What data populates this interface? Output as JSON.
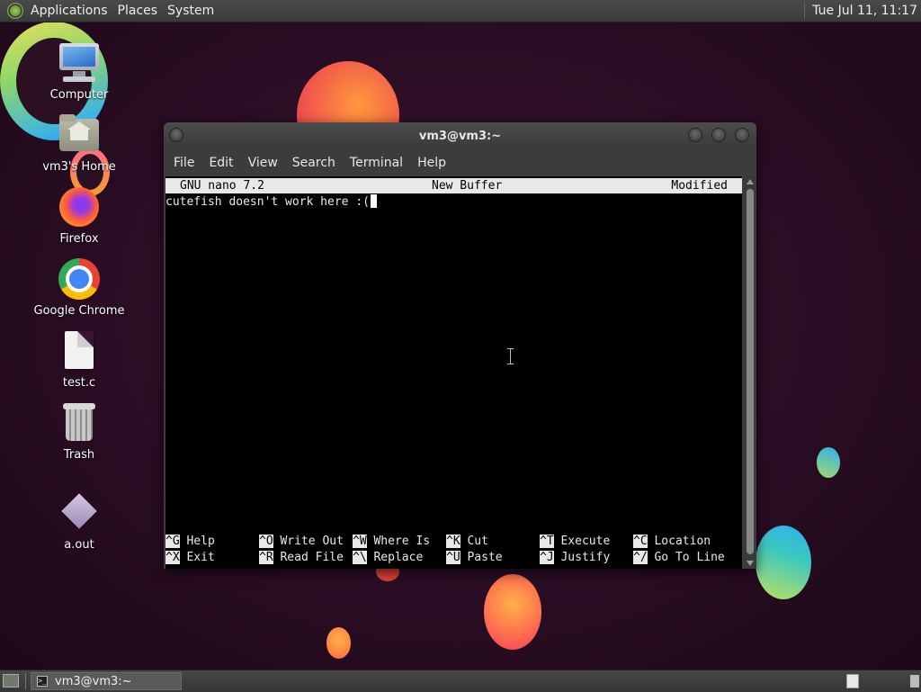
{
  "top_panel": {
    "menus": [
      "Applications",
      "Places",
      "System"
    ],
    "clock": "Tue Jul 11, 11:17"
  },
  "desktop": {
    "icons": [
      {
        "label": "Computer",
        "icon": "computer-icon"
      },
      {
        "label": "vm3's Home",
        "icon": "home-folder-icon"
      },
      {
        "label": "Firefox",
        "icon": "firefox-icon"
      },
      {
        "label": "Google Chrome",
        "icon": "chrome-icon"
      },
      {
        "label": "test.c",
        "icon": "text-file-icon"
      },
      {
        "label": "Trash",
        "icon": "trash-icon"
      },
      {
        "label": "a.out",
        "icon": "executable-icon"
      }
    ]
  },
  "terminal": {
    "title": "vm3@vm3:~",
    "menu": [
      "File",
      "Edit",
      "View",
      "Search",
      "Terminal",
      "Help"
    ],
    "nano_header": {
      "version": "GNU nano 7.2",
      "buffer": "New Buffer",
      "state": "Modified"
    },
    "buffer_text": "cutefish doesn't work here :(",
    "shortcuts_row1": [
      {
        "key": "^G",
        "label": "Help"
      },
      {
        "key": "^O",
        "label": "Write Out"
      },
      {
        "key": "^W",
        "label": "Where Is"
      },
      {
        "key": "^K",
        "label": "Cut"
      },
      {
        "key": "^T",
        "label": "Execute"
      },
      {
        "key": "^C",
        "label": "Location"
      }
    ],
    "shortcuts_row2": [
      {
        "key": "^X",
        "label": "Exit"
      },
      {
        "key": "^R",
        "label": "Read File"
      },
      {
        "key": "^\\",
        "label": "Replace"
      },
      {
        "key": "^U",
        "label": "Paste"
      },
      {
        "key": "^J",
        "label": "Justify"
      },
      {
        "key": "^/",
        "label": "Go To Line"
      }
    ]
  },
  "taskbar": {
    "window_button": "vm3@vm3:~"
  },
  "colors": {
    "panel": "#3f3f3f",
    "terminal_bg": "#000000",
    "terminal_fg": "#e8e8e8",
    "wallpaper": "#2b0f22"
  }
}
